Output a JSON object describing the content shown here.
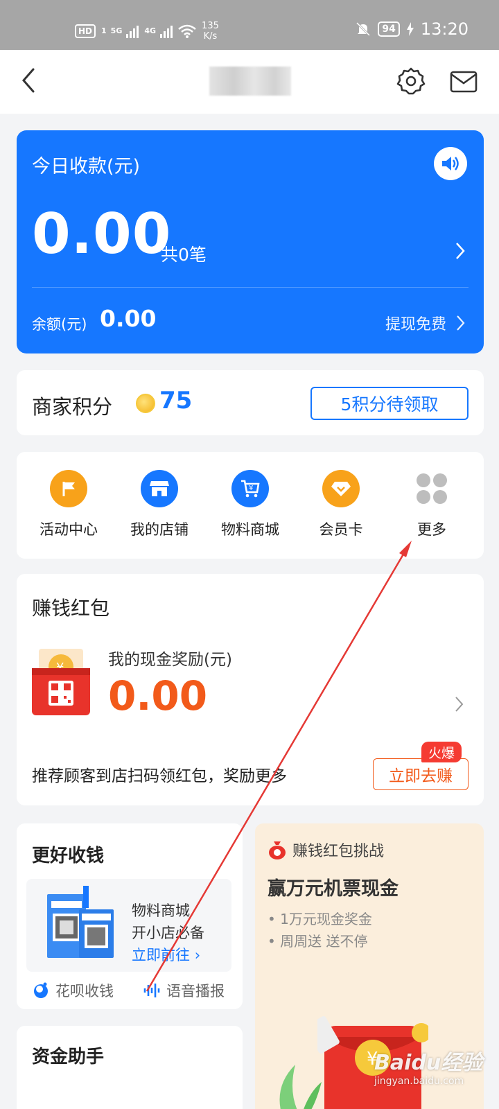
{
  "status_bar": {
    "hd": "HD",
    "hd_sim": "1",
    "net1": "5G",
    "net2": "4G",
    "speed_value": "135",
    "speed_unit": "K/s",
    "battery": "94",
    "time": "13:20"
  },
  "header": {
    "title_blurred": true
  },
  "today_card": {
    "title": "今日收款(元)",
    "amount": "0.00",
    "count": "共0笔",
    "balance_label": "余额(元)",
    "balance_value": "0.00",
    "withdraw_label": "提现免费",
    "color": "#1677ff"
  },
  "points": {
    "label": "商家积分",
    "value": "75",
    "claim_button": "5积分待领取"
  },
  "quick_actions": [
    {
      "label": "活动中心",
      "icon": "flag-icon",
      "color": "#f8a21a"
    },
    {
      "label": "我的店铺",
      "icon": "store-icon",
      "color": "#1677ff"
    },
    {
      "label": "物料商城",
      "icon": "cart-icon",
      "color": "#1677ff"
    },
    {
      "label": "会员卡",
      "icon": "diamond-icon",
      "color": "#f8a21a"
    },
    {
      "label": "更多",
      "icon": "more-grid-icon",
      "color": "#bdbdbd"
    }
  ],
  "red_packet": {
    "title": "赚钱红包",
    "reward_label": "我的现金奖励(元)",
    "reward_value": "0.00",
    "tip": "推荐顾客到店扫码领红包，奖励更多",
    "badge": "火爆",
    "action": "立即去赚",
    "accent": "#f25a1a"
  },
  "better_collect": {
    "title": "更好收钱",
    "line1": "物料商城",
    "line2": "开小店必备",
    "link": "立即前往",
    "feature1": "花呗收钱",
    "feature2": "语音播报"
  },
  "challenge": {
    "header": "赚钱红包挑战",
    "title": "赢万元机票现金",
    "bullet1": "• 1万元现金奖金",
    "bullet2": "• 周周送 送不停"
  },
  "funds": {
    "title": "资金助手"
  },
  "watermark": {
    "main": "Baidu经验",
    "sub": "jingyan.baidu.com"
  }
}
